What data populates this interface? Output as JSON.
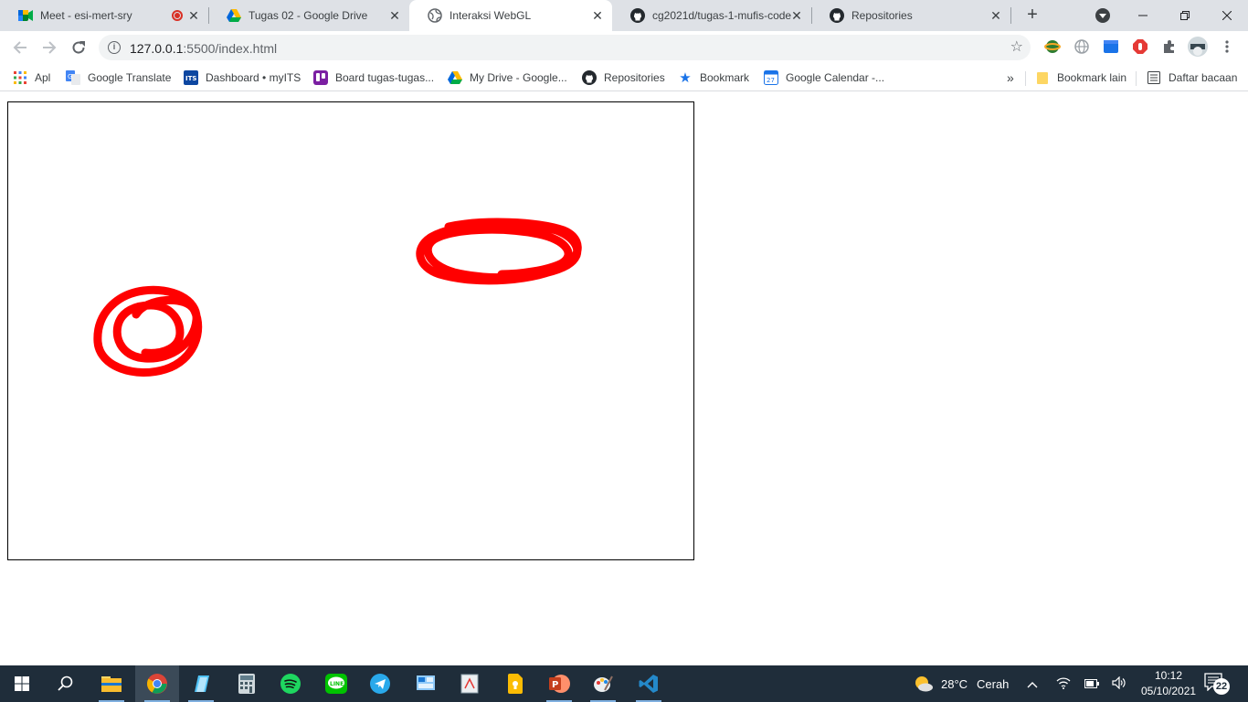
{
  "tabs": [
    {
      "title": "Meet - esi-mert-sry",
      "icon": "google-meet-icon",
      "recording": true
    },
    {
      "title": "Tugas 02 - Google Drive",
      "icon": "google-drive-icon"
    },
    {
      "title": "Interaksi WebGL",
      "icon": "globe-icon",
      "active": true
    },
    {
      "title": "cg2021d/tugas-1-mufis-code",
      "icon": "github-icon"
    },
    {
      "title": "Repositories",
      "icon": "github-icon"
    }
  ],
  "toolbar": {
    "url_host": "127.0.0.1",
    "url_path": ":5500/index.html"
  },
  "bookmarks": [
    {
      "label": "Apl",
      "icon": "apps-grid-icon"
    },
    {
      "label": "Google Translate",
      "icon": "google-translate-icon"
    },
    {
      "label": "Dashboard • myITS",
      "icon": "its-icon"
    },
    {
      "label": "Board tugas-tugas...",
      "icon": "trello-icon"
    },
    {
      "label": "My Drive - Google...",
      "icon": "google-drive-icon"
    },
    {
      "label": "Repositories",
      "icon": "github-icon"
    },
    {
      "label": "Bookmark",
      "icon": "star-icon"
    },
    {
      "label": "Google Calendar -...",
      "icon": "google-calendar-icon"
    }
  ],
  "bookmarks_right": {
    "other": "Bookmark lain",
    "reading_list": "Daftar bacaan",
    "calendar_day": "27"
  },
  "taskbar": {
    "weather_temp": "28°C",
    "weather_desc": "Cerah",
    "time": "10:12",
    "date": "05/10/2021",
    "notifications": "22"
  },
  "colors": {
    "stroke": "#ff0000",
    "taskbar_bg": "#1f2d3a",
    "tabstrip_bg": "#dee1e6"
  }
}
